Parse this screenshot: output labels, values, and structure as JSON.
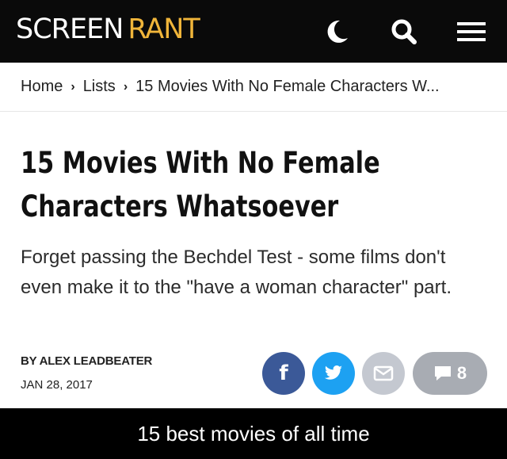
{
  "header": {
    "logo_word1": "SCREEN",
    "logo_word2": "RANT",
    "icons": [
      "moon-icon",
      "search-icon",
      "hamburger-menu-icon"
    ]
  },
  "breadcrumb": {
    "items": [
      "Home",
      "Lists",
      "15 Movies With No Female Characters W..."
    ]
  },
  "article": {
    "title": "15 Movies With No Female Characters Whatsoever",
    "subtitle": "Forget passing the Bechdel Test - some films don't even make it to the \"have a woman character\" part.",
    "byline": "BY ALEX LEADBEATER",
    "date": "JAN 28, 2017"
  },
  "share": {
    "facebook_label": "f",
    "comment_count": "8"
  },
  "caption": "15 best movies of all time",
  "colors": {
    "header_bg": "#0a0a0a",
    "logo_accent": "#f0b53a",
    "facebook": "#3b5998",
    "twitter": "#1da1f2",
    "email": "#c4c8d0",
    "comments": "#a8acb3"
  }
}
